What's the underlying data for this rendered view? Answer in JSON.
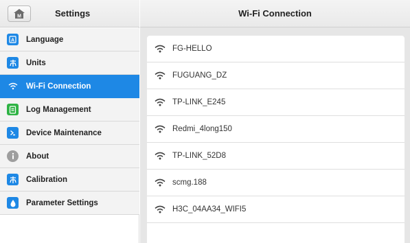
{
  "app": {
    "title": "Settings"
  },
  "sidebar": {
    "home_icon": "home-icon",
    "items": [
      {
        "label": "Language",
        "icon": "language-icon",
        "active": false
      },
      {
        "label": "Units",
        "icon": "units-icon",
        "active": false
      },
      {
        "label": "Wi-Fi Connection",
        "icon": "wifi-icon",
        "active": true
      },
      {
        "label": "Log Management",
        "icon": "log-icon",
        "active": false
      },
      {
        "label": "Device Maintenance",
        "icon": "maintenance-icon",
        "active": false
      },
      {
        "label": "About",
        "icon": "info-icon",
        "active": false
      },
      {
        "label": "Calibration",
        "icon": "calibration-icon",
        "active": false
      },
      {
        "label": "Parameter Settings",
        "icon": "parameter-icon",
        "active": false
      }
    ]
  },
  "main": {
    "title": "Wi-Fi Connection",
    "networks": [
      {
        "ssid": "FG-HELLO"
      },
      {
        "ssid": "FUGUANG_DZ"
      },
      {
        "ssid": "TP-LINK_E245"
      },
      {
        "ssid": "Redmi_4long150"
      },
      {
        "ssid": "TP-LINK_52D8"
      },
      {
        "ssid": "scmg.188"
      },
      {
        "ssid": "H3C_04AA34_WIFI5"
      }
    ]
  },
  "colors": {
    "accent": "#1e88e5",
    "log_icon": "#2fb344",
    "about_icon": "#9e9e9e"
  }
}
